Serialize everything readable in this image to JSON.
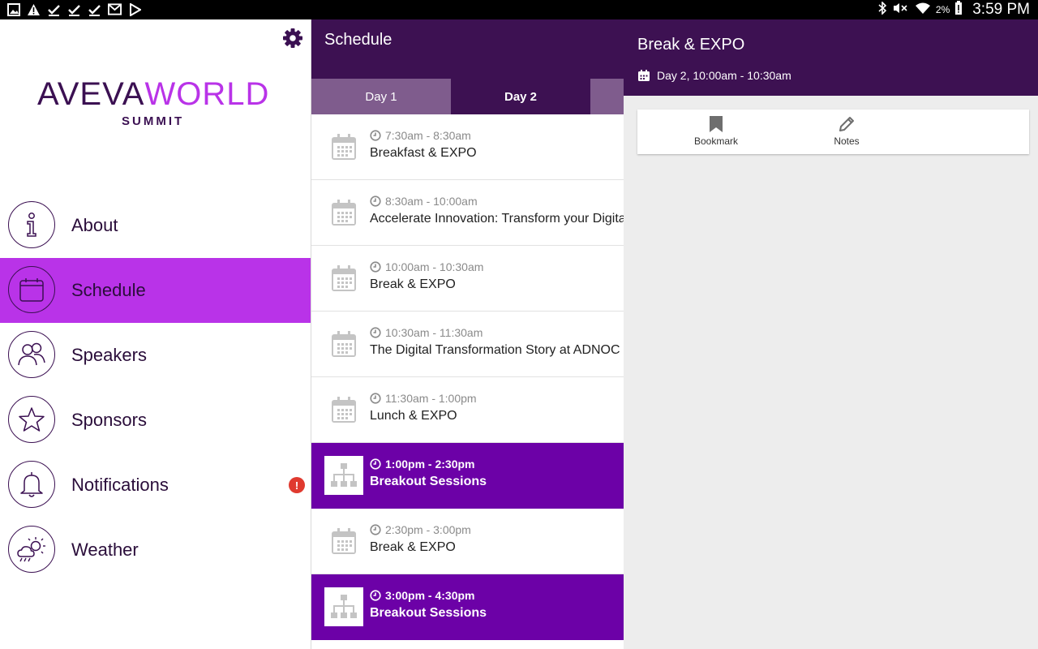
{
  "status_bar": {
    "time": "3:59 PM",
    "battery": "2%",
    "left_icons": [
      "image-icon",
      "warning-icon",
      "check-icon",
      "check-icon",
      "check-icon",
      "gmail-icon",
      "play-store-icon"
    ],
    "right_icons": [
      "bluetooth-icon",
      "mute-icon",
      "wifi-icon",
      "battery-alert-icon"
    ]
  },
  "drawer": {
    "logo": {
      "part1": "AVEVA",
      "part2": "WORLD",
      "subtitle": "SUMMIT"
    },
    "items": [
      {
        "label": "About",
        "icon": "info-icon",
        "active": false
      },
      {
        "label": "Schedule",
        "icon": "calendar-icon",
        "active": true
      },
      {
        "label": "Speakers",
        "icon": "people-icon",
        "active": false
      },
      {
        "label": "Sponsors",
        "icon": "star-icon",
        "active": false
      },
      {
        "label": "Notifications",
        "icon": "bell-icon",
        "active": false,
        "badge": "!"
      },
      {
        "label": "Weather",
        "icon": "weather-icon",
        "active": false
      }
    ]
  },
  "schedule": {
    "title": "Schedule",
    "tabs": [
      {
        "label": "Day 1",
        "active": false
      },
      {
        "label": "Day 2",
        "active": true
      },
      {
        "label": "",
        "active": false
      }
    ],
    "sessions": [
      {
        "time": "7:30am - 8:30am",
        "title": "Breakfast & EXPO",
        "icon": "calendar-icon",
        "highlight": false
      },
      {
        "time": "8:30am - 10:00am",
        "title": "Accelerate Innovation: Transform your Digita",
        "icon": "calendar-icon",
        "highlight": false
      },
      {
        "time": "10:00am - 10:30am",
        "title": "Break & EXPO",
        "icon": "calendar-icon",
        "highlight": false
      },
      {
        "time": "10:30am - 11:30am",
        "title": "The Digital Transformation Story at ADNOC",
        "icon": "calendar-icon",
        "highlight": false
      },
      {
        "time": "11:30am - 1:00pm",
        "title": "Lunch & EXPO",
        "icon": "calendar-icon",
        "highlight": false
      },
      {
        "time": "1:00pm - 2:30pm",
        "title": "Breakout Sessions",
        "icon": "hierarchy-icon",
        "highlight": true
      },
      {
        "time": "2:30pm - 3:00pm",
        "title": "Break & EXPO",
        "icon": "calendar-icon",
        "highlight": false
      },
      {
        "time": "3:00pm - 4:30pm",
        "title": "Breakout Sessions",
        "icon": "hierarchy-icon",
        "highlight": true
      }
    ]
  },
  "detail": {
    "title": "Break & EXPO",
    "meta": "Day 2, 10:00am - 10:30am",
    "actions": [
      {
        "label": "Bookmark",
        "icon": "bookmark-icon"
      },
      {
        "label": "Notes",
        "icon": "pencil-icon"
      }
    ]
  },
  "colors": {
    "header_purple": "#3d1152",
    "accent_magenta": "#b933e8",
    "highlight_purple": "#6c01a7",
    "tab_inactive": "#7f5c8d",
    "alert_red": "#e03a2f"
  }
}
